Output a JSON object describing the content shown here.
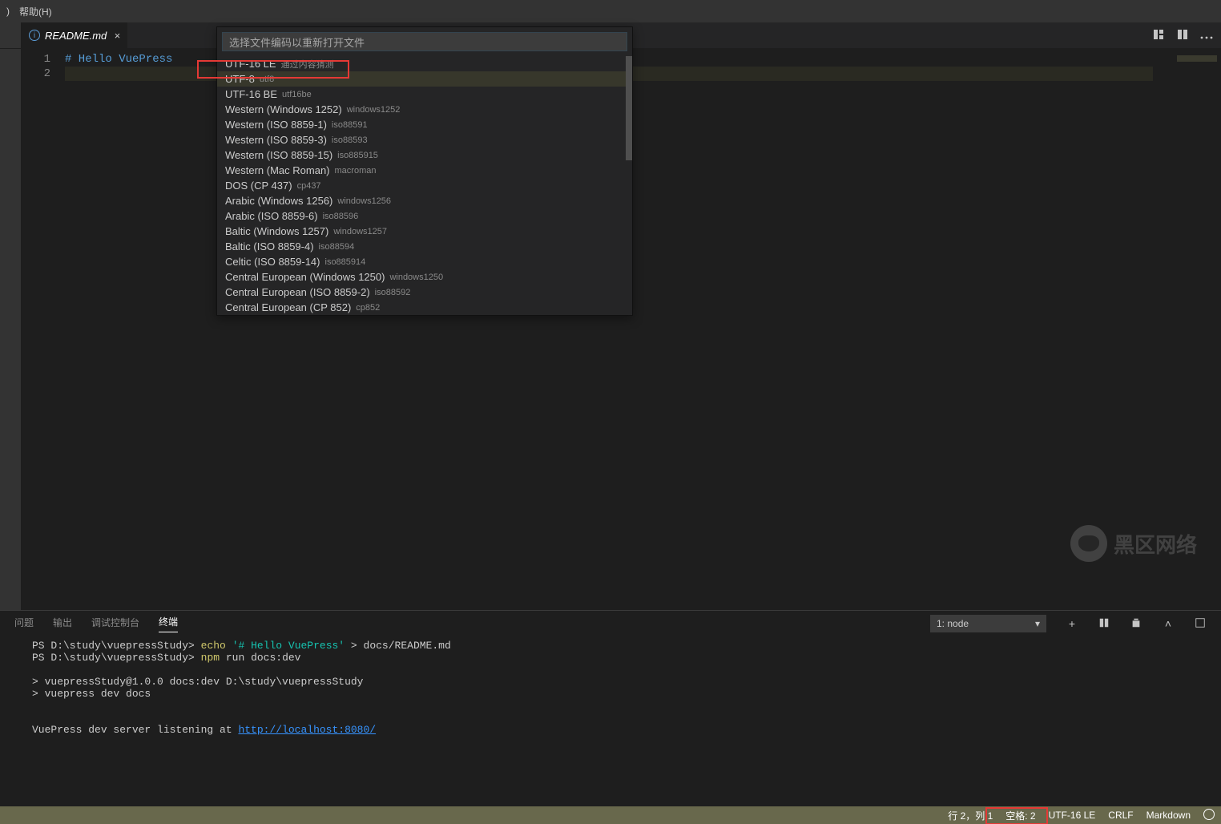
{
  "menubar": {
    "truncated": ")",
    "help": "帮助(H)"
  },
  "tab": {
    "filename": "README.md"
  },
  "editor": {
    "lines": [
      1,
      2
    ],
    "code_line_1": "# Hello VuePress"
  },
  "quickpick": {
    "placeholder": "选择文件编码以重新打开文件",
    "items": [
      {
        "label": "UTF-16 LE",
        "sub": "通过内容猜测"
      },
      {
        "label": "UTF-8",
        "sub": "utf8"
      },
      {
        "label": "UTF-16 BE",
        "sub": "utf16be"
      },
      {
        "label": "Western (Windows 1252)",
        "sub": "windows1252"
      },
      {
        "label": "Western (ISO 8859-1)",
        "sub": "iso88591"
      },
      {
        "label": "Western (ISO 8859-3)",
        "sub": "iso88593"
      },
      {
        "label": "Western (ISO 8859-15)",
        "sub": "iso885915"
      },
      {
        "label": "Western (Mac Roman)",
        "sub": "macroman"
      },
      {
        "label": "DOS (CP 437)",
        "sub": "cp437"
      },
      {
        "label": "Arabic (Windows 1256)",
        "sub": "windows1256"
      },
      {
        "label": "Arabic (ISO 8859-6)",
        "sub": "iso88596"
      },
      {
        "label": "Baltic (Windows 1257)",
        "sub": "windows1257"
      },
      {
        "label": "Baltic (ISO 8859-4)",
        "sub": "iso88594"
      },
      {
        "label": "Celtic (ISO 8859-14)",
        "sub": "iso885914"
      },
      {
        "label": "Central European (Windows 1250)",
        "sub": "windows1250"
      },
      {
        "label": "Central European (ISO 8859-2)",
        "sub": "iso88592"
      },
      {
        "label": "Central European (CP 852)",
        "sub": "cp852"
      }
    ],
    "selected_index": 1
  },
  "panel": {
    "tabs": {
      "problems": "问题",
      "output": "输出",
      "debug": "调试控制台",
      "terminal": "终端"
    },
    "select_value": "1: node",
    "terminal": {
      "prompt1_path": "PS D:\\study\\vuepressStudy>",
      "cmd1_echo": "echo",
      "cmd1_str": "'# Hello VuePress'",
      "cmd1_rest": " > docs/README.md",
      "prompt2_path": "PS D:\\study\\vuepressStudy>",
      "cmd2_npm": "npm",
      "cmd2_rest": " run docs:dev",
      "out1": "> vuepressStudy@1.0.0 docs:dev D:\\study\\vuepressStudy",
      "out2": "> vuepress dev docs",
      "out3a": " VuePress dev server listening at ",
      "out3_link": "http://localhost:8080/"
    }
  },
  "statusbar": {
    "ln_col": "行 2，列 1",
    "spaces": "空格: 2",
    "encoding": "UTF-16 LE",
    "eol": "CRLF",
    "lang": "Markdown"
  },
  "watermark": "黑区网络"
}
